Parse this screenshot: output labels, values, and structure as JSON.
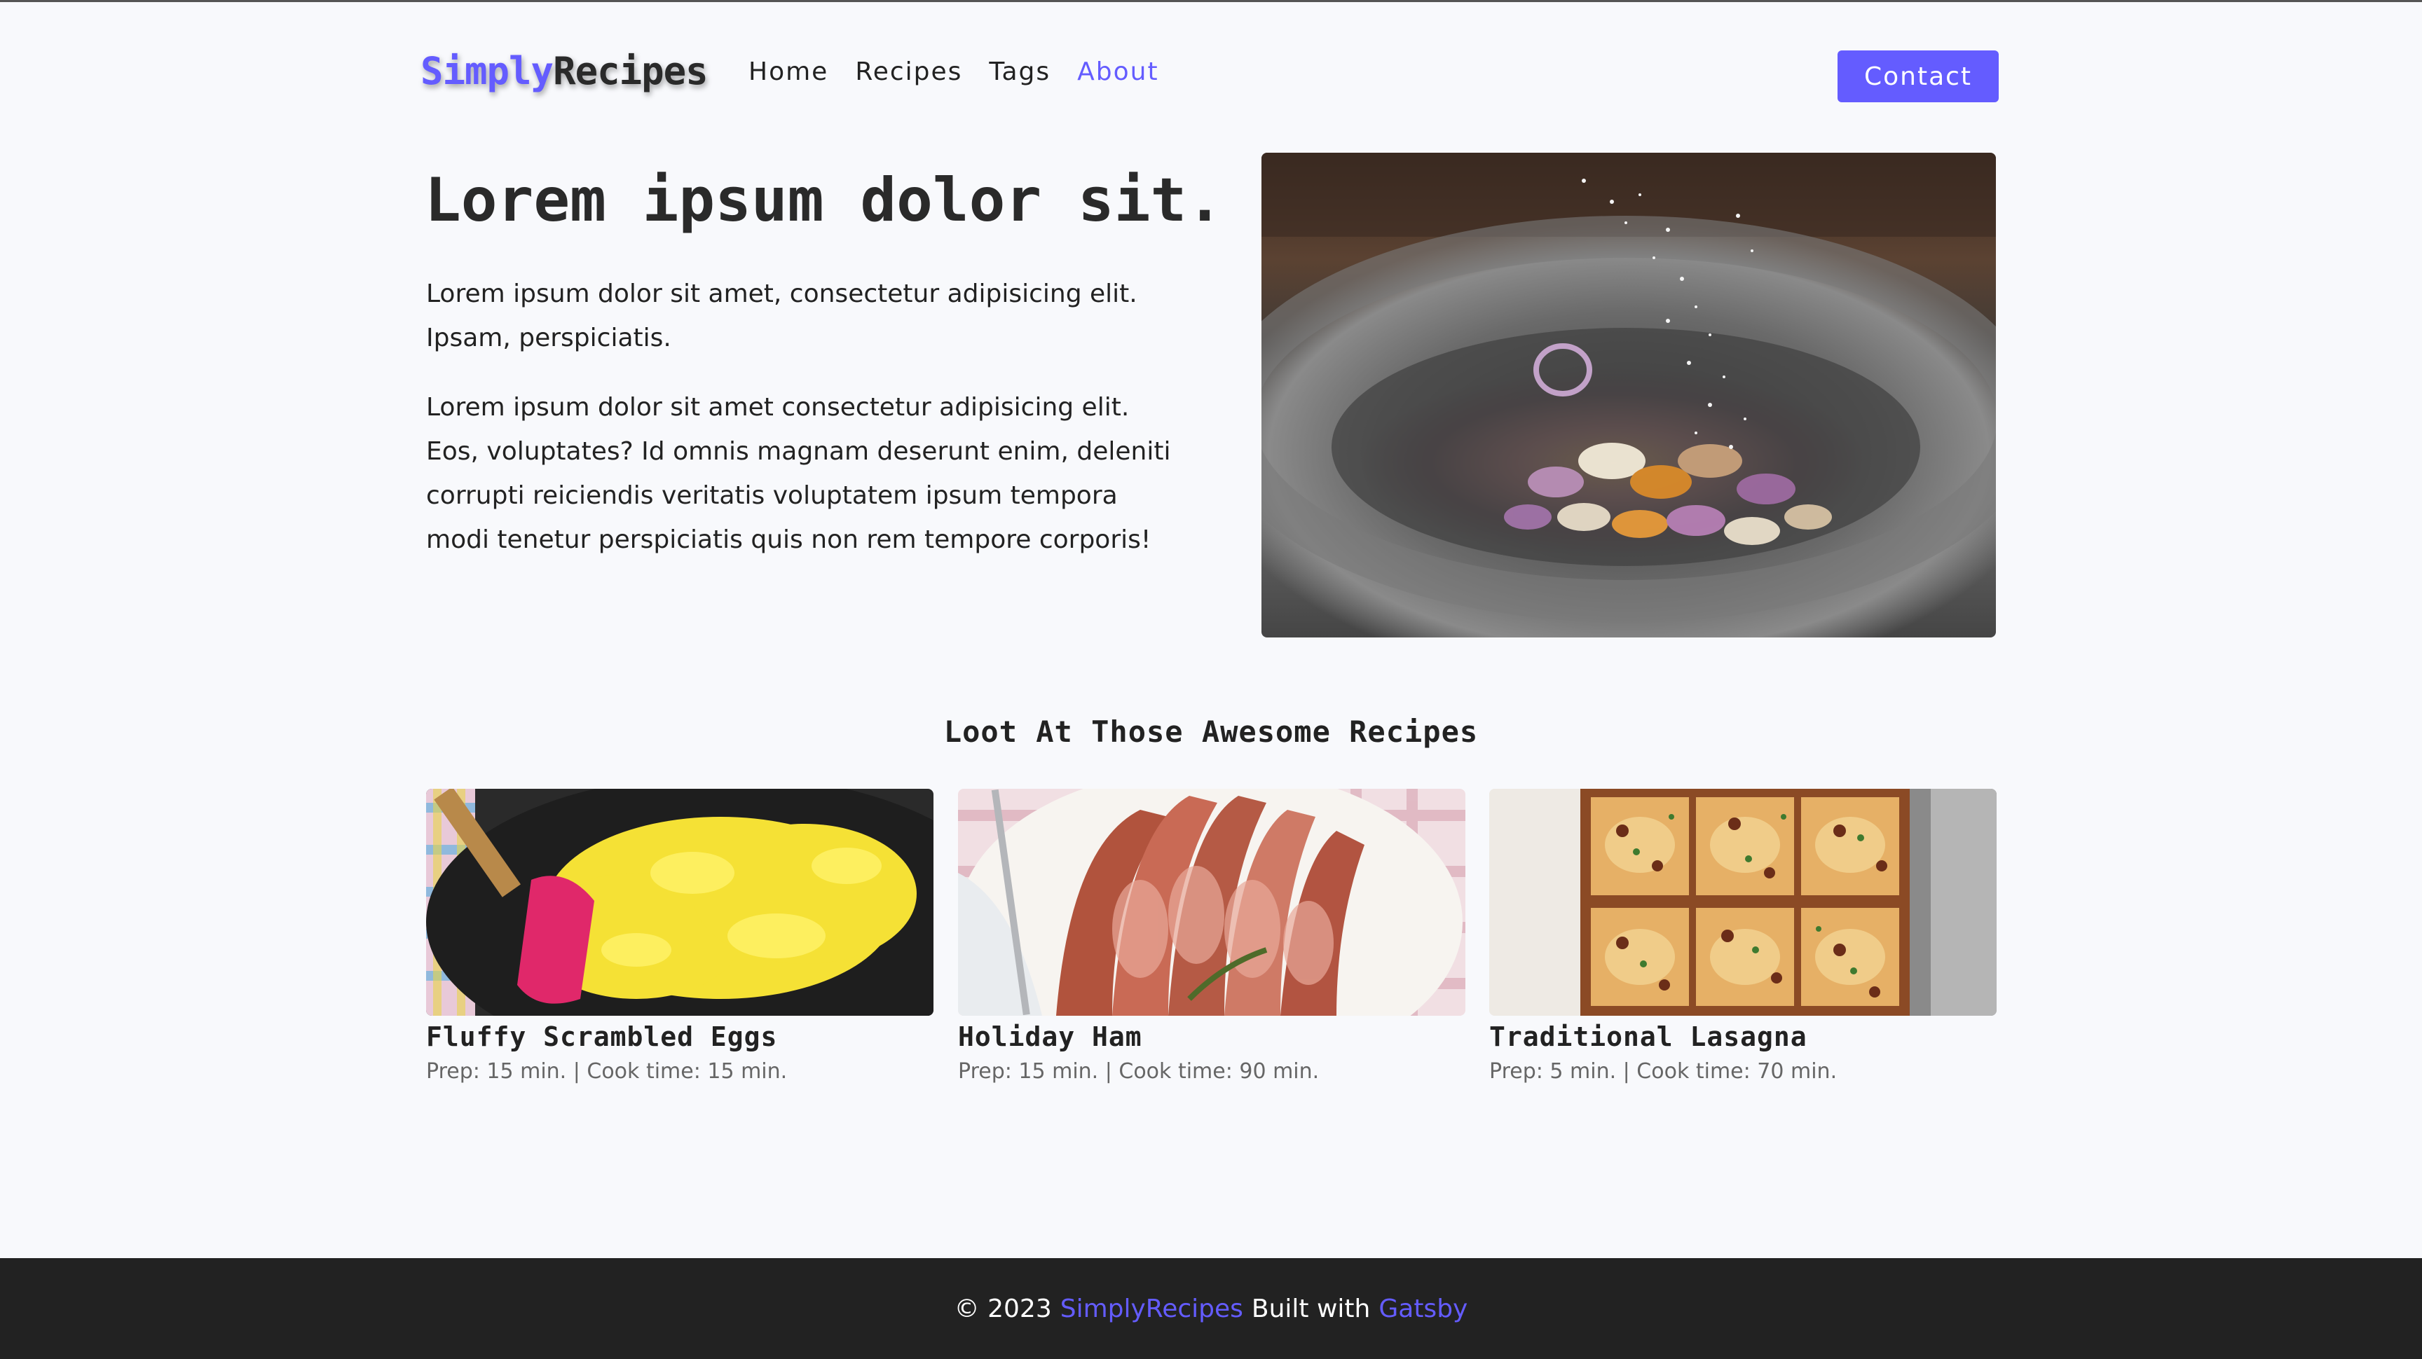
{
  "brand": {
    "logo_part1": "Simply",
    "logo_part2": "Recipes",
    "accent_color": "#645cff"
  },
  "nav": {
    "items": [
      {
        "label": "Home",
        "active": false
      },
      {
        "label": "Recipes",
        "active": false
      },
      {
        "label": "Tags",
        "active": false
      },
      {
        "label": "About",
        "active": true
      }
    ],
    "contact_label": "Contact"
  },
  "hero": {
    "title": "Lorem ipsum dolor sit.",
    "paragraph1": "Lorem ipsum dolor sit amet, consectetur adipisicing elit. Ipsam, perspiciatis.",
    "paragraph2": "Lorem ipsum dolor sit amet consectetur adipisicing elit. Eos, voluptates? Id omnis magnam deserunt enim, deleniti corrupti reiciendis veritatis voluptatem ipsum tempora modi tenetur perspiciatis quis non rem tempore corporis!"
  },
  "featured": {
    "heading": "Loot At Those Awesome Recipes",
    "recipes": [
      {
        "title": "Fluffy Scrambled Eggs",
        "meta": "Prep: 15 min. | Cook time: 15 min."
      },
      {
        "title": "Holiday Ham",
        "meta": "Prep: 15 min. | Cook time: 90 min."
      },
      {
        "title": "Traditional Lasagna",
        "meta": "Prep: 5 min. | Cook time: 70 min."
      }
    ]
  },
  "footer": {
    "copyright": "© 2023",
    "brand_link": "SimplyRecipes",
    "built_with": "Built with",
    "framework_link": "Gatsby"
  }
}
